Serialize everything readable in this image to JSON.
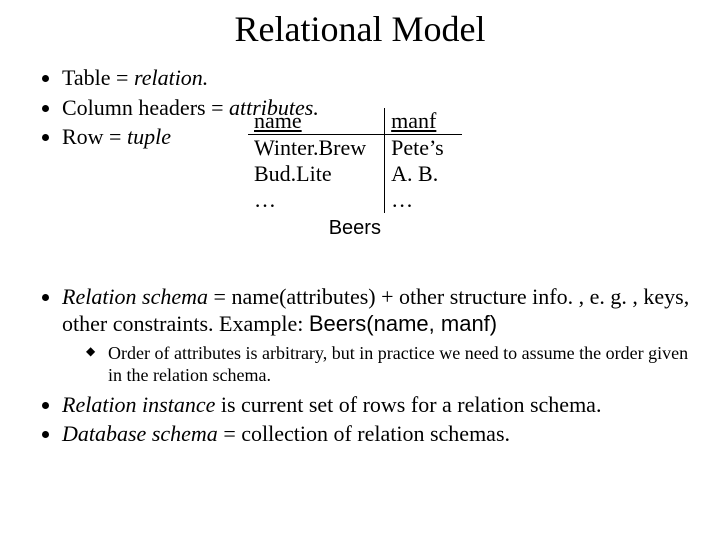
{
  "title": "Relational Model",
  "bullets": {
    "b1_pre": "Table = ",
    "b1_em": "relation.",
    "b2_pre": "Column headers = ",
    "b2_em": "attributes.",
    "b3_pre": "Row = ",
    "b3_em": "tuple"
  },
  "table": {
    "headers": {
      "c1": "name",
      "c2": "manf"
    },
    "rows": [
      {
        "c1": "Winter.Brew",
        "c2": "Pete’s"
      },
      {
        "c1": "Bud.Lite",
        "c2": "A. B."
      },
      {
        "c1": "…",
        "c2": "…"
      }
    ],
    "caption": "Beers"
  },
  "bullets2": {
    "b4_em": "Relation schema",
    "b4_mid": " = name(attributes) + other structure info. , e. g. , keys, other constraints. Example: ",
    "b4_sans": "Beers(name, manf)",
    "b4_sub": "Order of attributes is arbitrary, but in practice we need to assume the order given in the relation schema.",
    "b5_em": "Relation instance",
    "b5_rest": " is current set of rows for a relation schema.",
    "b6_em": "Database schema",
    "b6_rest": " = collection of relation schemas."
  }
}
